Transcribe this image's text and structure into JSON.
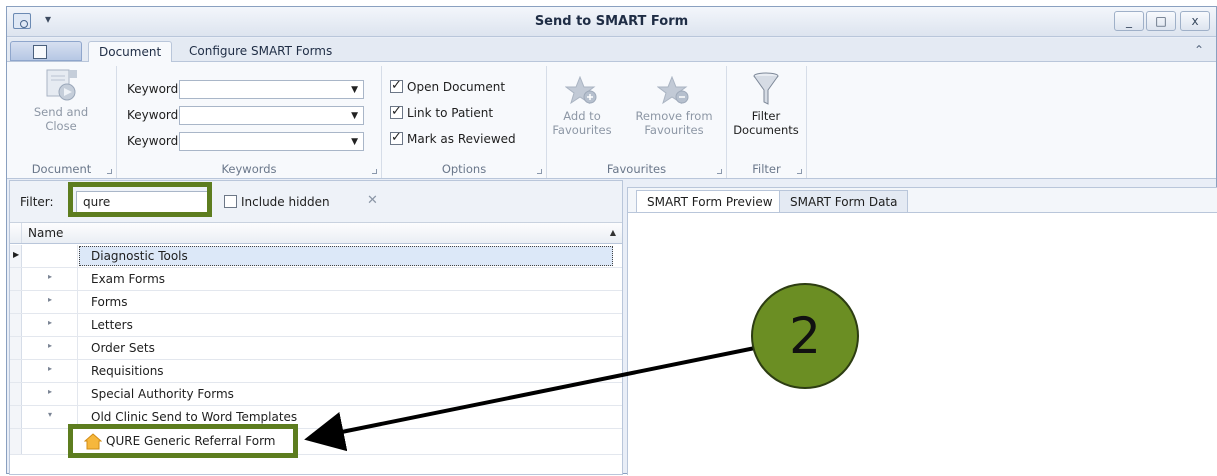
{
  "window": {
    "title": "Send to SMART Form",
    "quick_access": "▾",
    "controls": {
      "minimize": "_",
      "maximize": "□",
      "close": "x"
    },
    "collapse_icon": "⌃"
  },
  "ribbon_tabs": [
    "Document",
    "Configure SMART Forms"
  ],
  "groups": {
    "document": {
      "label": "Document",
      "send_close": [
        "Send and",
        "Close"
      ]
    },
    "keywords": {
      "label": "Keywords",
      "rows": [
        {
          "label": "Keyword",
          "value": ""
        },
        {
          "label": "Keyword",
          "value": ""
        },
        {
          "label": "Keyword",
          "value": ""
        }
      ]
    },
    "options": {
      "label": "Options",
      "items": [
        {
          "label": "Open Document",
          "checked": true
        },
        {
          "label": "Link to Patient",
          "checked": true
        },
        {
          "label": "Mark as Reviewed",
          "checked": true
        }
      ]
    },
    "favourites": {
      "label": "Favourites",
      "add": [
        "Add to",
        "Favourites"
      ],
      "remove": [
        "Remove from",
        "Favourites"
      ]
    },
    "filter": {
      "label": "Filter",
      "button": [
        "Filter",
        "Documents"
      ]
    }
  },
  "filter_bar": {
    "label": "Filter:",
    "value": "qure",
    "include_hidden": "Include hidden",
    "clear_icon": "✕"
  },
  "grid": {
    "column": "Name",
    "sort_icon": "▲",
    "rows": [
      {
        "name": "Diagnostic Tools",
        "expander": "",
        "selected": true
      },
      {
        "name": "Exam Forms",
        "expander": "▸"
      },
      {
        "name": "Forms",
        "expander": "▸"
      },
      {
        "name": "Letters",
        "expander": "▸"
      },
      {
        "name": "Order Sets",
        "expander": "▸"
      },
      {
        "name": "Requisitions",
        "expander": "▸"
      },
      {
        "name": "Special Authority Forms",
        "expander": "▸"
      },
      {
        "name": "Old Clinic Send to Word Templates",
        "expander": "▾"
      }
    ],
    "child": {
      "name": "QURE Generic Referral Form"
    }
  },
  "preview_tabs": [
    "SMART Form Preview",
    "SMART Form Data"
  ],
  "annotation": {
    "number": "2",
    "color": "#6b8e23",
    "highlight_color": "#5d7d1f"
  }
}
